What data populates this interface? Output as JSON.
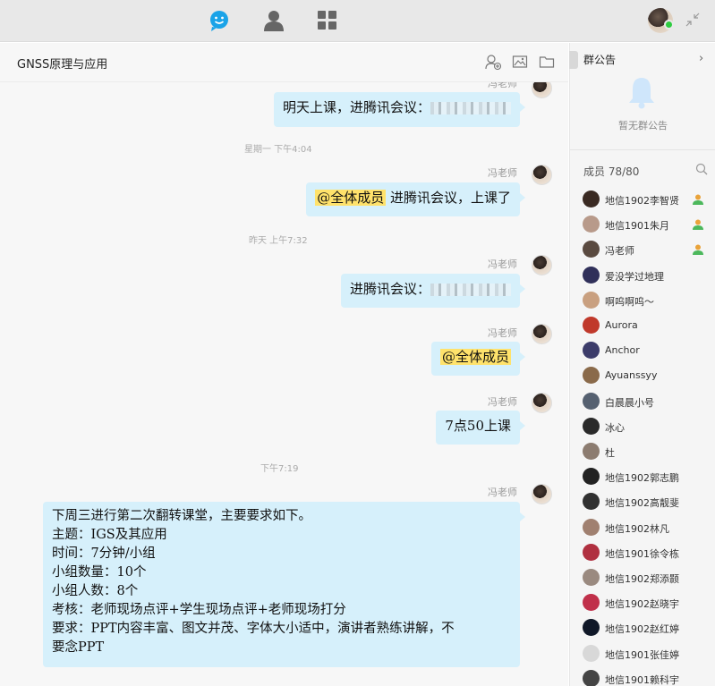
{
  "top_nav": {
    "icons": [
      "chat-icon",
      "contacts-icon",
      "apps-icon"
    ]
  },
  "chat": {
    "title": "GNSS原理与应用",
    "messages": [
      {
        "sender": "冯老师",
        "parts": [
          "明天上课，进腾讯会议："
        ]
      },
      {
        "time": "星期一  下午4:04"
      },
      {
        "sender": "冯老师",
        "mention": "@全体成员",
        "text": " 进腾讯会议，上课了"
      },
      {
        "time": "昨天  上午7:32"
      },
      {
        "sender": "冯老师",
        "text": "进腾讯会议："
      },
      {
        "sender": "冯老师",
        "mention": "@全体成员"
      },
      {
        "sender": "冯老师",
        "text": "7点50上课"
      },
      {
        "time": "下午7:19"
      },
      {
        "sender": "冯老师",
        "lines": [
          "下周三进行第二次翻转课堂，主要要求如下。",
          "主题：IGS及其应用",
          "时间：7分钟/小组",
          "小组数量：10个",
          "小组人数：8个",
          "考核：老师现场点评+学生现场点评+老师现场打分",
          "要求：PPT内容丰富、图文并茂、字体大小适中，演讲者熟练讲解，不",
          "要念PPT"
        ]
      }
    ]
  },
  "panel": {
    "notice_title": "群公告",
    "no_notice": "暂无群公告",
    "members_label": "成员 78/80",
    "members": [
      {
        "name": "地信1902李智贤",
        "admin": true,
        "color": "#3a2a22"
      },
      {
        "name": "地信1901朱月",
        "admin": true,
        "color": "#b89a8a"
      },
      {
        "name": "冯老师",
        "admin": true,
        "color": "#5a4a40"
      },
      {
        "name": "爱没学过地理",
        "admin": false,
        "color": "#30305a"
      },
      {
        "name": "啊呜啊呜～",
        "admin": false,
        "color": "#c9a080"
      },
      {
        "name": "Aurora",
        "admin": false,
        "color": "#c0392b"
      },
      {
        "name": "Anchor",
        "admin": false,
        "color": "#3c3c6a"
      },
      {
        "name": "Ayuanssyy",
        "admin": false,
        "color": "#8a6a4a"
      },
      {
        "name": "白晨晨小号",
        "admin": false,
        "color": "#556070"
      },
      {
        "name": "冰心",
        "admin": false,
        "color": "#2a2a2a"
      },
      {
        "name": "杜",
        "admin": false,
        "color": "#8c7c70"
      },
      {
        "name": "地信1902郭志鹏",
        "admin": false,
        "color": "#222222"
      },
      {
        "name": "地信1902高靓斐",
        "admin": false,
        "color": "#303030"
      },
      {
        "name": "地信1902林凡",
        "admin": false,
        "color": "#a08070"
      },
      {
        "name": "地信1901徐令栋",
        "admin": false,
        "color": "#b03040"
      },
      {
        "name": "地信1902郑添颢",
        "admin": false,
        "color": "#9a8a80"
      },
      {
        "name": "地信1902赵晓宇",
        "admin": false,
        "color": "#c0304a"
      },
      {
        "name": "地信1902赵红婷",
        "admin": false,
        "color": "#101828"
      },
      {
        "name": "地信1901张佳婷",
        "admin": false,
        "color": "#d8d8d8"
      },
      {
        "name": "地信1901赖科宇",
        "admin": false,
        "color": "#444444"
      }
    ]
  },
  "colors": {
    "bubble": "#d6f0fb",
    "mention": "#ffe26b",
    "online": "#2ecc40",
    "accent": "#1aa3e8"
  }
}
